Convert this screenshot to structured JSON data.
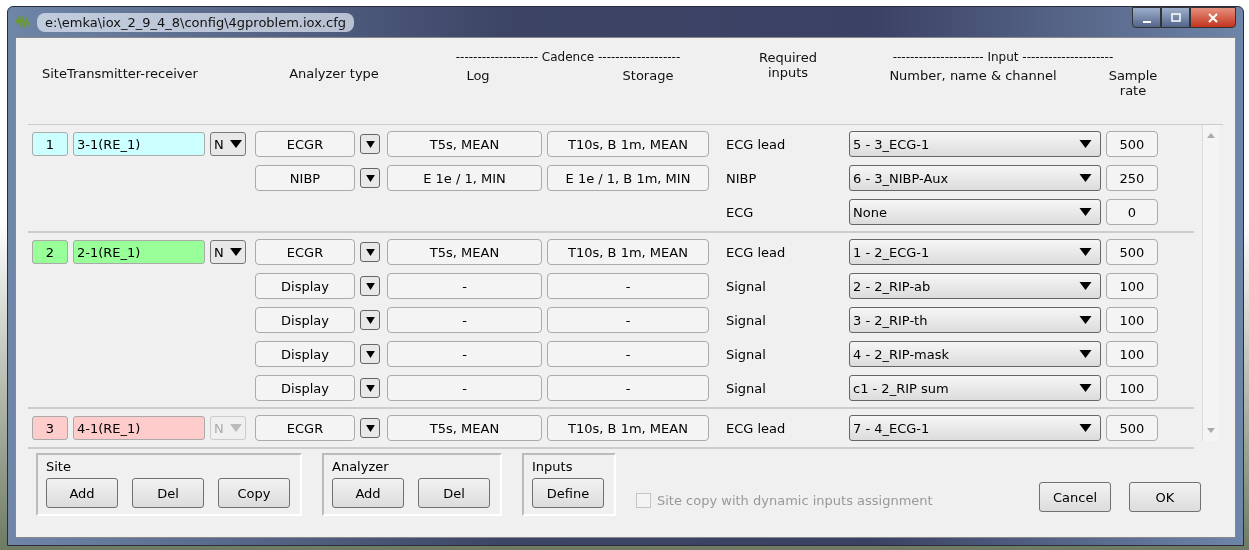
{
  "window": {
    "title": "e:\\emka\\iox_2_9_4_8\\config\\4gproblem.iox.cfg"
  },
  "headers": {
    "site": "Site",
    "transmitter": "Transmitter-receiver",
    "analyzer_type": "Analyzer type",
    "cadence": "------------------- Cadence -------------------",
    "log": "Log",
    "storage": "Storage",
    "required": "Required inputs",
    "input": "--------------------- Input ---------------------",
    "channel": "Number, name & channel",
    "rate": "Sample rate"
  },
  "sites": [
    {
      "number": "1",
      "transmitter": "3-1(RE_1)",
      "color": "#ccffff",
      "mode": "N",
      "disabled": false,
      "analyzers": [
        {
          "type": "ECGR",
          "log": "T5s, MEAN",
          "storage": "T10s, B 1m, MEAN",
          "inputs": [
            {
              "required": "ECG lead",
              "channel": "5 - 3_ECG-1",
              "rate": "500"
            }
          ]
        },
        {
          "type": "NIBP",
          "log": "E 1e / 1, MIN",
          "storage": "E 1e / 1, B 1m, MIN",
          "inputs": [
            {
              "required": "NIBP",
              "channel": "6 - 3_NIBP-Aux",
              "rate": "250"
            },
            {
              "required": "ECG",
              "channel": "None",
              "rate": "0"
            }
          ]
        }
      ]
    },
    {
      "number": "2",
      "transmitter": "2-1(RE_1)",
      "color": "#99ff99",
      "mode": "N",
      "disabled": false,
      "analyzers": [
        {
          "type": "ECGR",
          "log": "T5s, MEAN",
          "storage": "T10s, B 1m, MEAN",
          "inputs": [
            {
              "required": "ECG lead",
              "channel": "1 - 2_ECG-1",
              "rate": "500"
            }
          ]
        },
        {
          "type": "Display",
          "log": "-",
          "storage": "-",
          "inputs": [
            {
              "required": "Signal",
              "channel": "2 - 2_RIP-ab",
              "rate": "100"
            }
          ]
        },
        {
          "type": "Display",
          "log": "-",
          "storage": "-",
          "inputs": [
            {
              "required": "Signal",
              "channel": "3 - 2_RIP-th",
              "rate": "100"
            }
          ]
        },
        {
          "type": "Display",
          "log": "-",
          "storage": "-",
          "inputs": [
            {
              "required": "Signal",
              "channel": "4 - 2_RIP-mask",
              "rate": "100"
            }
          ]
        },
        {
          "type": "Display",
          "log": "-",
          "storage": "-",
          "inputs": [
            {
              "required": "Signal",
              "channel": "c1 - 2_RIP sum",
              "rate": "100"
            }
          ]
        }
      ]
    },
    {
      "number": "3",
      "transmitter": "4-1(RE_1)",
      "color": "#ffcccc",
      "mode": "N",
      "disabled": true,
      "analyzers": [
        {
          "type": "ECGR",
          "log": "T5s, MEAN",
          "storage": "T10s, B 1m, MEAN",
          "inputs": [
            {
              "required": "ECG lead",
              "channel": "7 - 4_ECG-1",
              "rate": "500"
            }
          ]
        }
      ]
    }
  ],
  "groups": [
    {
      "title": "Site",
      "buttons": [
        {
          "label": "Add"
        },
        {
          "label": "Del"
        },
        {
          "label": "Copy"
        }
      ]
    },
    {
      "title": "Analyzer",
      "buttons": [
        {
          "label": "Add"
        },
        {
          "label": "Del"
        }
      ]
    },
    {
      "title": "Inputs",
      "buttons": [
        {
          "label": "Define"
        }
      ]
    }
  ],
  "option": {
    "label": "Site copy with dynamic inputs assignment",
    "checked": false,
    "disabled": true
  },
  "actions": [
    {
      "label": "Cancel"
    },
    {
      "label": "OK"
    }
  ]
}
